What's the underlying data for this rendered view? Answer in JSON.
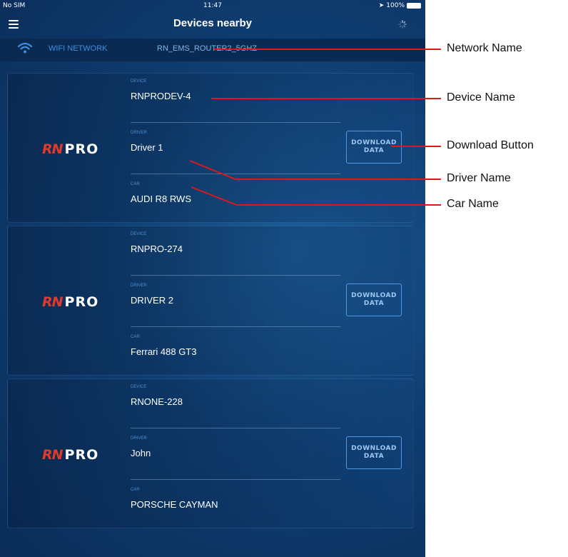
{
  "status_bar": {
    "carrier": "No SIM",
    "time": "11:47",
    "battery": "100%"
  },
  "nav": {
    "title": "Devices nearby"
  },
  "wifi": {
    "label": "WIFI NETWORK",
    "name": "RN_EMS_ROUTER2_5GHZ"
  },
  "labels": {
    "device": "DEVICE",
    "driver": "DRIVER",
    "car": "CAR"
  },
  "download_button": "DOWNLOAD\nDATA",
  "logo": {
    "rn": "RN",
    "pro": "PRO"
  },
  "devices": [
    {
      "device": "RNPRODEV-4",
      "driver": "Driver 1",
      "car": "AUDI R8 RWS"
    },
    {
      "device": "RNPRO-274",
      "driver": "DRIVER 2",
      "car": "Ferrari 488 GT3"
    },
    {
      "device": "RNONE-228",
      "driver": "John",
      "car": "PORSCHE CAYMAN"
    }
  ],
  "callouts": {
    "network_name": "Network Name",
    "device_name": "Device Name",
    "download_button": "Download Button",
    "driver_name": "Driver Name",
    "car_name": "Car Name"
  },
  "colors": {
    "callout_line": "#e0161b",
    "accent": "#4f9ae6",
    "logo_red": "#e03a2a"
  }
}
